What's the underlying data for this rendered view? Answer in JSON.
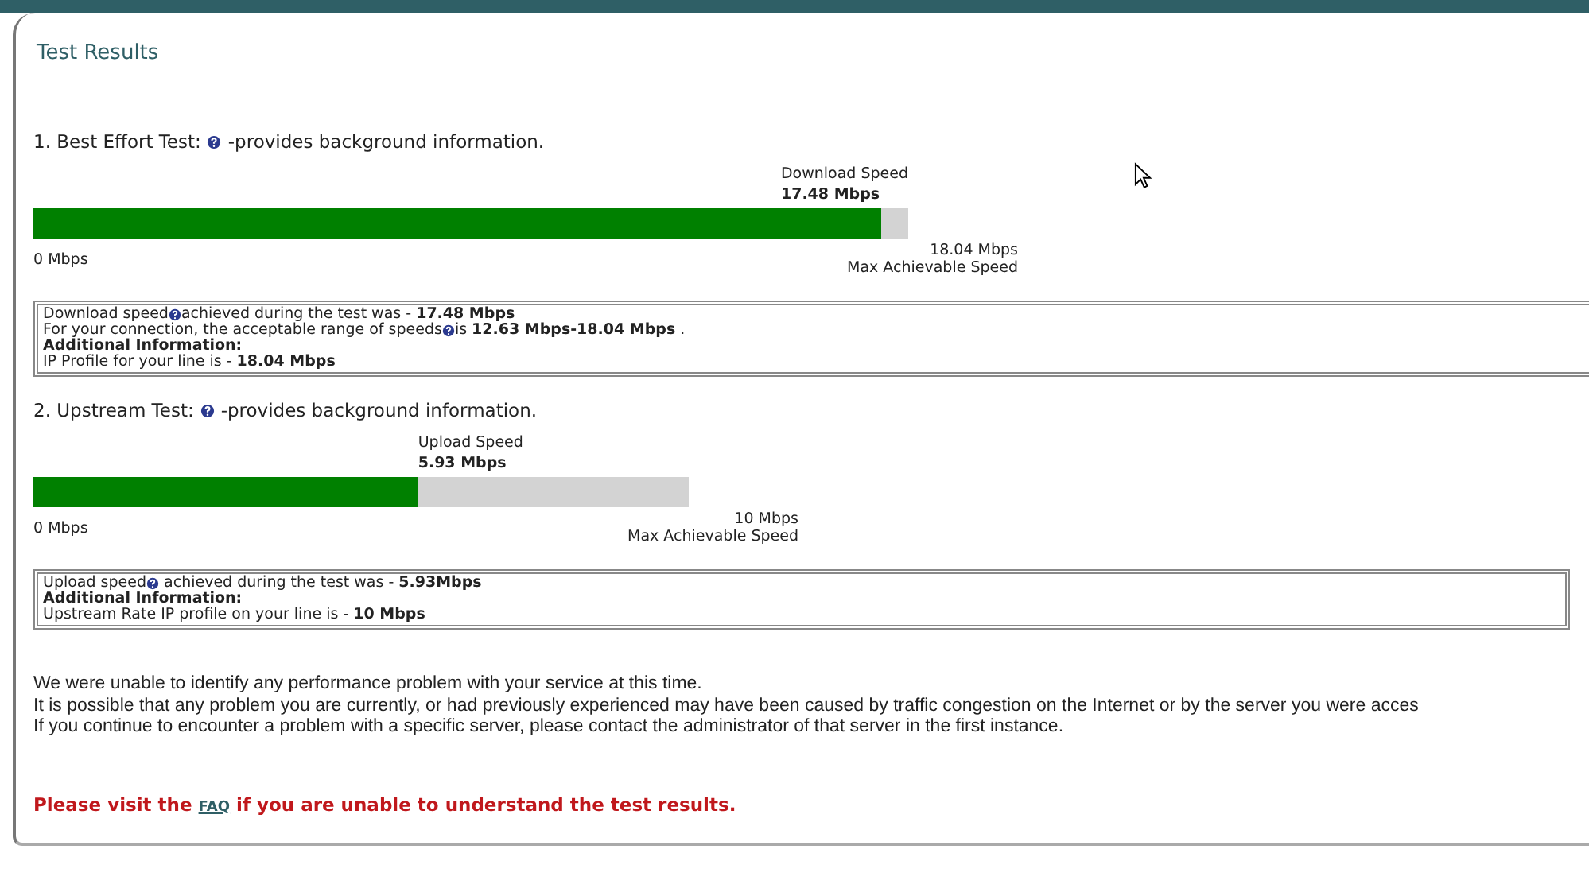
{
  "title": "Test Results",
  "tests": [
    {
      "title": "1. Best Effort Test:",
      "description": "-provides background information.",
      "speed_label": "Download Speed",
      "speed_value": "17.48 Mbps",
      "level": 0.969,
      "min_label": "0 Mbps",
      "max_value": "18.04 Mbps",
      "max_label": "Max Achievable Speed",
      "info": [
        {
          "kind": "text",
          "parts": [
            "Download speed",
            "achieved during the test was - **17.48 Mbps**"
          ]
        },
        {
          "kind": "text",
          "parts": [
            "For your connection, the acceptable range of speeds",
            "is **12.63 Mbps-18.04 Mbps** ."
          ]
        },
        {
          "kind": "heading",
          "parts": [
            "Additional Information:"
          ]
        },
        {
          "kind": "text",
          "parts": [
            "IP Profile for your line is - **18.04 Mbps**"
          ]
        }
      ]
    },
    {
      "title": "2. Upstream Test:",
      "description": "-provides background information.",
      "speed_label": "Upload Speed",
      "speed_value": "5.93 Mbps",
      "level": 0.587,
      "min_label": "0 Mbps",
      "max_value": "10 Mbps",
      "max_label": "Max Achievable Speed",
      "info": [
        {
          "kind": "text",
          "parts": [
            "Upload speed",
            " achieved during the test was - **5.93Mbps**"
          ]
        },
        {
          "kind": "heading",
          "parts": [
            "Additional Information:"
          ]
        },
        {
          "kind": "text",
          "parts": [
            "Upstream Rate IP profile on your line is - **10 Mbps**"
          ]
        }
      ]
    }
  ],
  "summary": [
    "We were unable to identify any performance problem with your service at this time.",
    "It is possible that any problem you are currently, or had previously experienced may have been caused by traffic congestion on the Internet or by the server you were acces",
    "If you continue to encounter a problem with a specific server, please contact the administrator of that server in the first instance."
  ],
  "footer": {
    "before": "Please visit the",
    "link": "FAQ",
    "after": "if you are unable to understand the test results."
  }
}
